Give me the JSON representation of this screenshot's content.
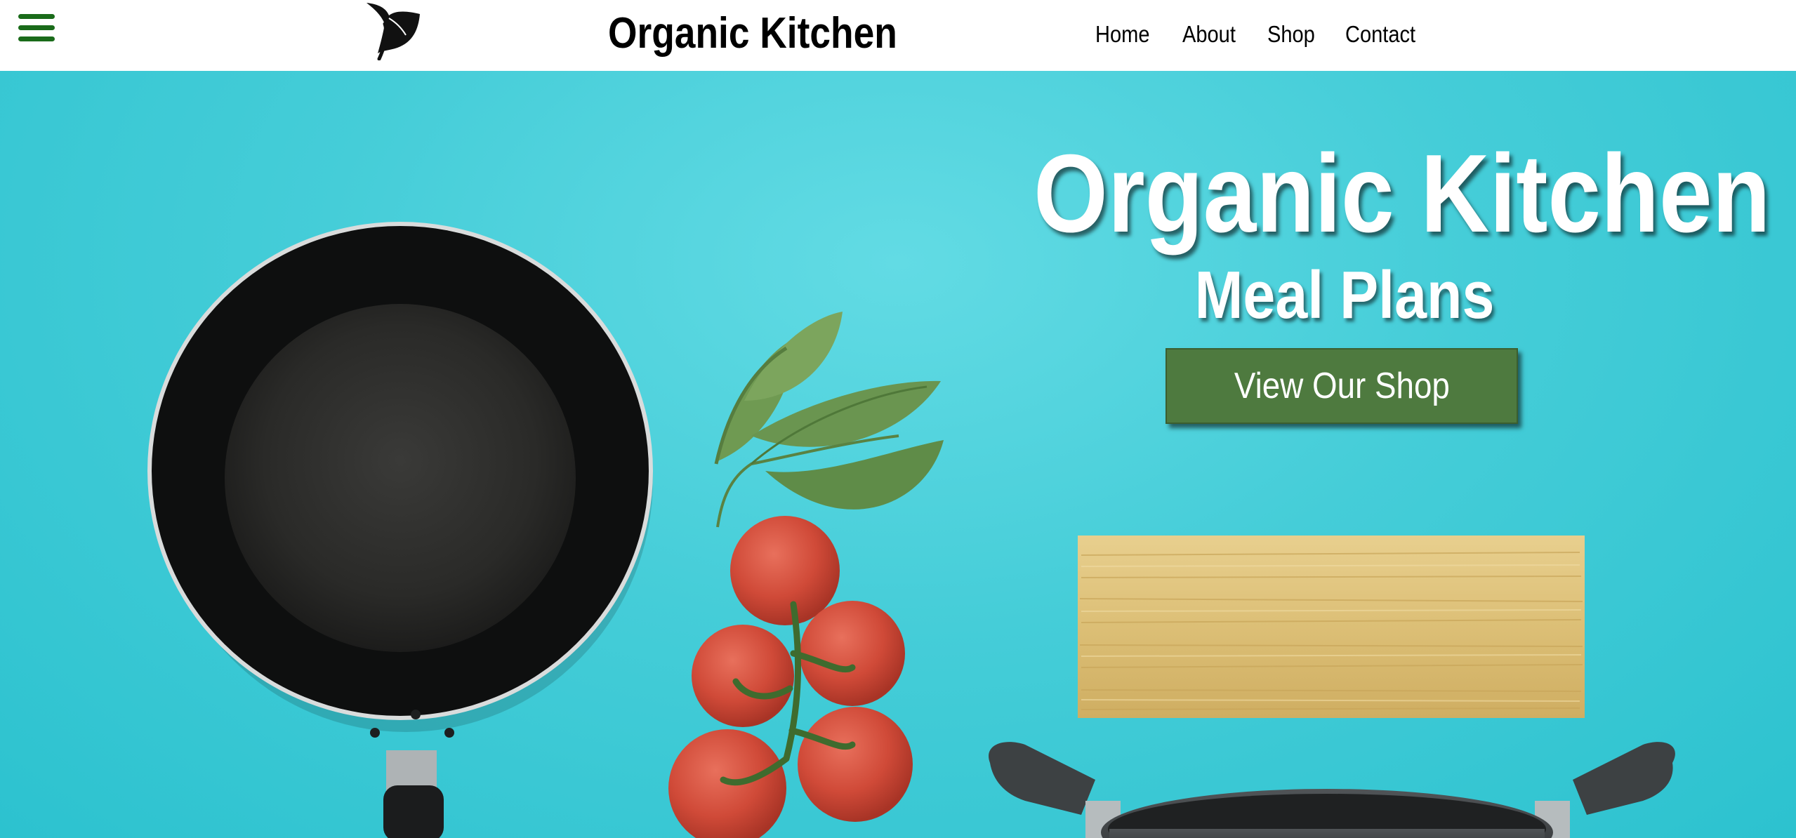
{
  "header": {
    "menu_icon": "hamburger-menu-icon",
    "logo_icon": "leaf-logo-icon",
    "brand": "Organic Kitchen",
    "nav": [
      {
        "label": "Home"
      },
      {
        "label": "About"
      },
      {
        "label": "Shop"
      },
      {
        "label": "Contact"
      }
    ]
  },
  "hero": {
    "title": "Organic Kitchen",
    "subtitle": "Meal Plans",
    "cta_label": "View Our Shop",
    "background_color": "#45cdd8",
    "cta_color": "#4e7a3f"
  },
  "colors": {
    "menu_icon": "#1a6b1a",
    "brand_text": "#000000"
  }
}
